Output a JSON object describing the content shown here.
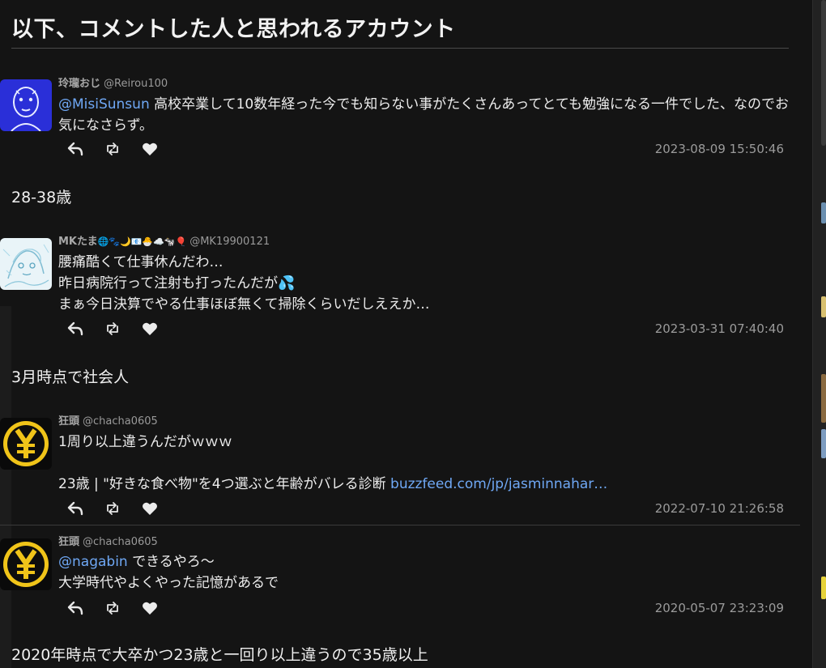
{
  "heading": "以下、コメントした人と思われるアカウント",
  "tweets": [
    {
      "name": "玲瓏おじ",
      "handle": "@Reirou100",
      "mention": "@MisiSunsun",
      "text": " 高校卒業して10数年経った今でも知らない事がたくさんあってとても勉強になる一件でした、なのでお気になさらず。",
      "timestamp": "2023-08-09 15:50:46",
      "avatar": "face-drawing-avatar"
    },
    {
      "name": "MKたま",
      "name_emoji": "🌐🐾🌙📧🐣☁️🐄🎈",
      "handle": "@MK19900121",
      "lines": [
        "腰痛酷くて仕事休んだわ…",
        "昨日病院行って注射も打ったんだが💦",
        "まぁ今日決算でやる仕事ほぼ無くて掃除くらいだしええか…"
      ],
      "timestamp": "2023-03-31 07:40:40",
      "avatar": "sketch-avatar"
    },
    {
      "name": "狂頭",
      "handle": "@chacha0605",
      "lines": [
        "1周り以上違うんだがｗｗｗ",
        ""
      ],
      "card_text": "23歳 | \"好きな食べ物\"を4つ選ぶと年齢がバレる診断 ",
      "card_link": "buzzfeed.com/jp/jasminnahar…",
      "timestamp": "2022-07-10 21:26:58",
      "avatar": "yen-coin-avatar"
    },
    {
      "name": "狂頭",
      "handle": "@chacha0605",
      "mention": "@nagabin",
      "mention_rest": " できるやろ〜",
      "lines": [
        "大学時代やよくやった記憶があるで"
      ],
      "timestamp": "2020-05-07 23:23:09",
      "avatar": "yen-coin-avatar"
    }
  ],
  "comments": [
    "28-38歳",
    "3月時点で社会人",
    "2020年時点で大卒かつ23歳と一回り以上違うので35歳以上"
  ],
  "icons": {
    "reply": "reply-icon",
    "retweet": "retweet-icon",
    "like": "heart-icon"
  },
  "colors": {
    "background": "#141414",
    "link": "#6fa8f5",
    "timestamp": "#9b9b9b"
  }
}
